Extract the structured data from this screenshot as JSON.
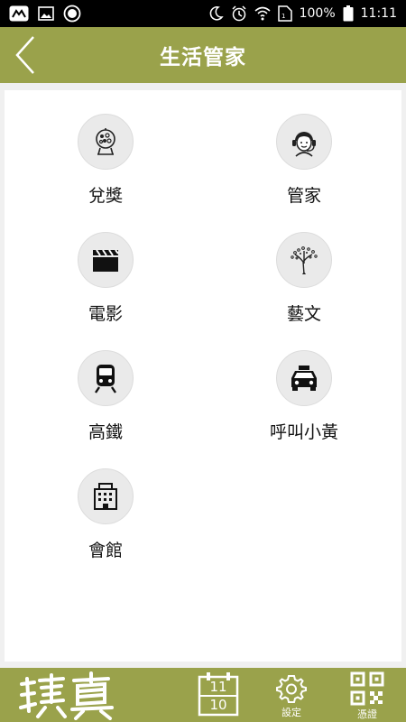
{
  "status_bar": {
    "battery": "100%",
    "time": "11:11",
    "icons": [
      "app-icon",
      "image-icon",
      "record-icon",
      "moon-icon",
      "alarm-icon",
      "wifi-icon",
      "sim-icon",
      "battery-icon"
    ]
  },
  "header": {
    "title": "生活管家",
    "back_icon": "chevron-left-icon"
  },
  "menu": {
    "items": [
      {
        "label": "兌獎",
        "icon": "lottery-icon"
      },
      {
        "label": "管家",
        "icon": "headset-person-icon"
      },
      {
        "label": "電影",
        "icon": "clapperboard-icon"
      },
      {
        "label": "藝文",
        "icon": "tree-art-icon"
      },
      {
        "label": "高鐵",
        "icon": "train-icon"
      },
      {
        "label": "呼叫小黃",
        "icon": "taxi-icon"
      },
      {
        "label": "會館",
        "icon": "building-icon"
      }
    ]
  },
  "bottom_nav": {
    "logo_icon": "brand-logo",
    "calendar": {
      "top": "11",
      "bottom": "10",
      "icon": "calendar-icon"
    },
    "settings": {
      "label": "設定",
      "icon": "gear-icon"
    },
    "credential": {
      "label": "憑證",
      "icon": "qr-code-icon"
    }
  },
  "colors": {
    "accent": "#9aa24b",
    "background": "#f0f0f0",
    "status_bar": "#000000"
  }
}
